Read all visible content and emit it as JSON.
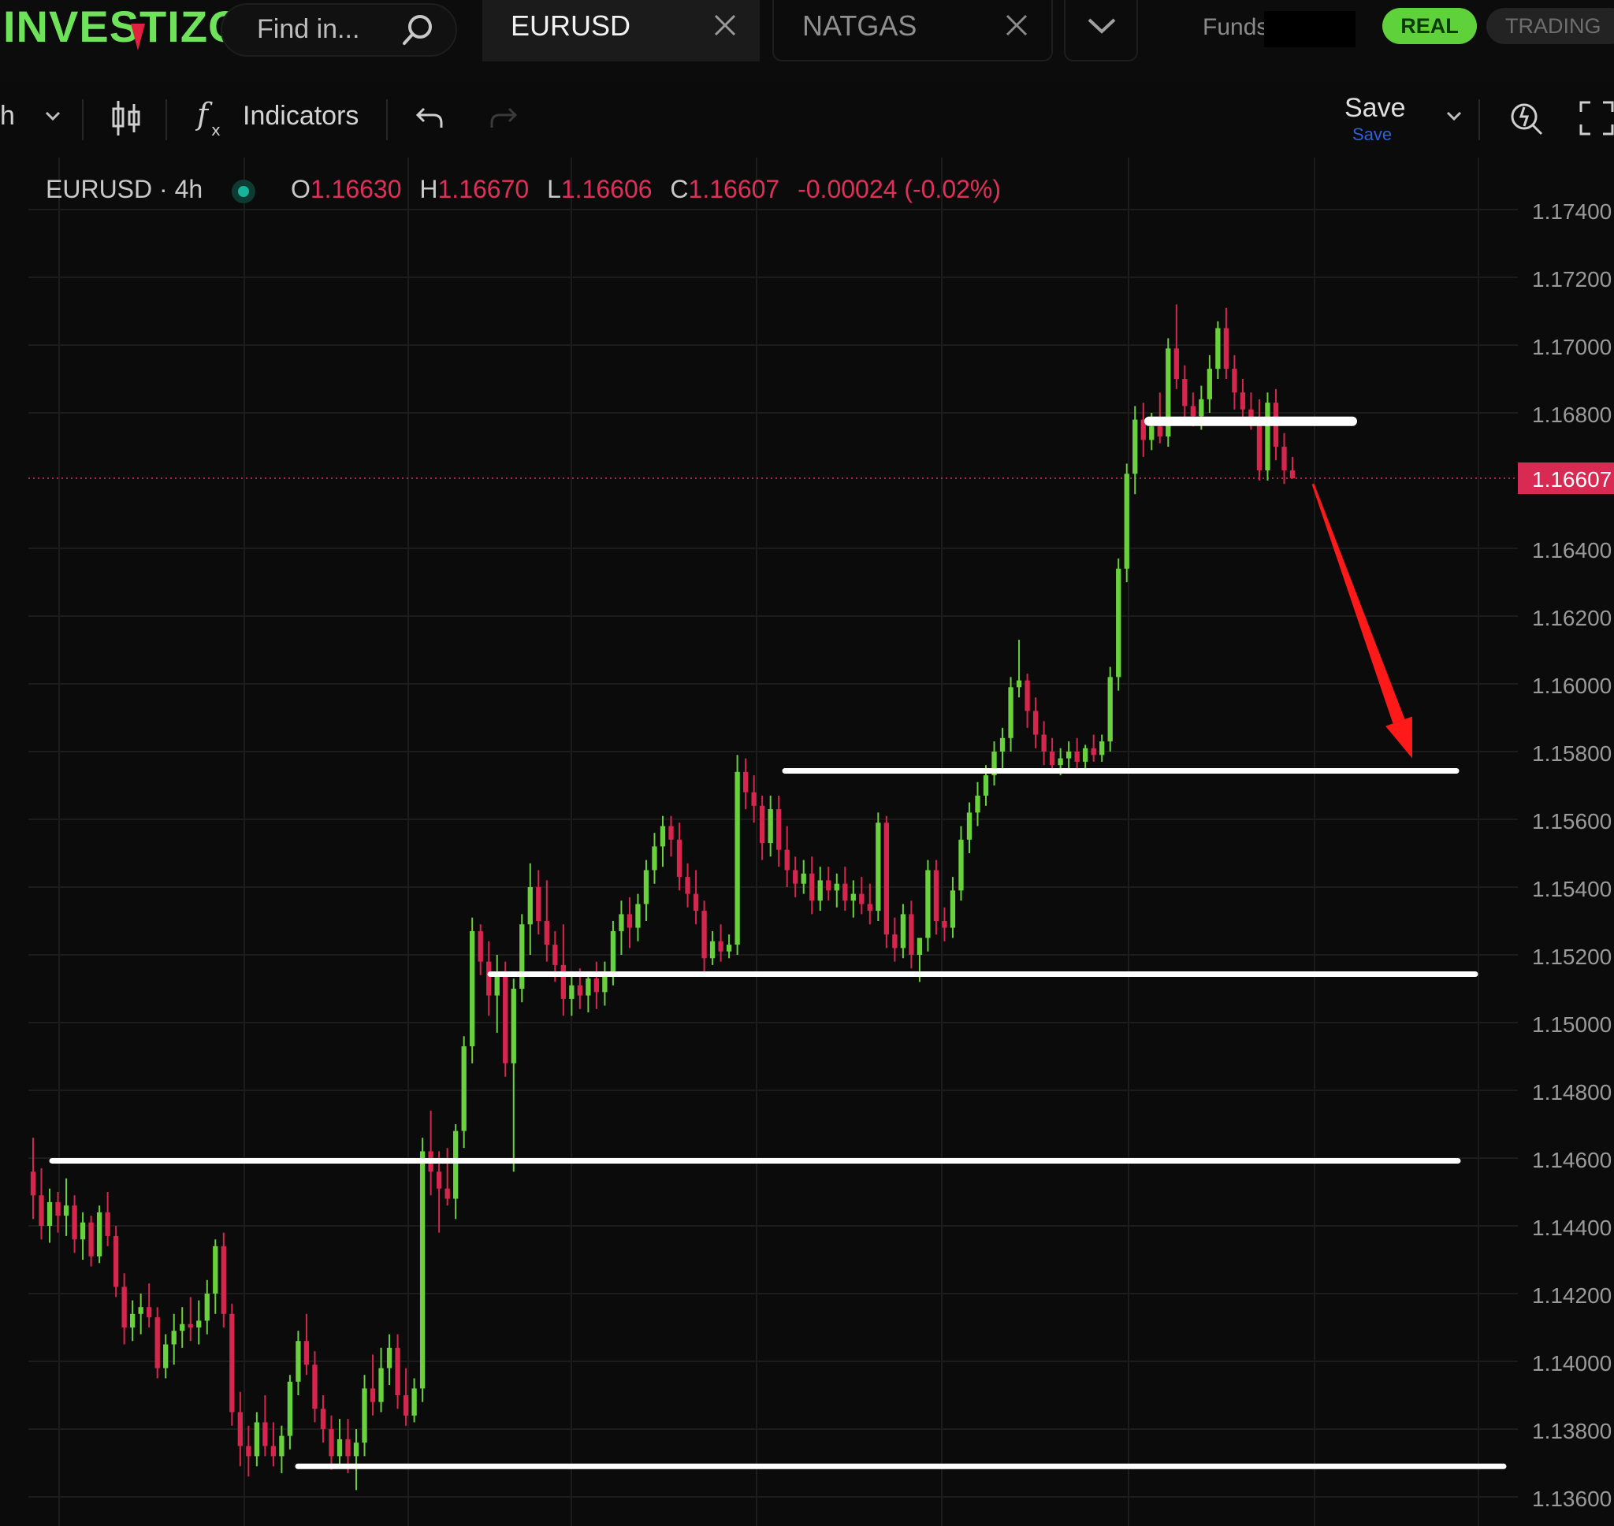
{
  "app": {
    "logo_text": "INVESTIZO"
  },
  "search": {
    "placeholder": "Find in..."
  },
  "tabs": [
    {
      "label": "EURUSD",
      "active": true
    },
    {
      "label": "NATGAS",
      "active": false
    }
  ],
  "account": {
    "funds_label": "Funds",
    "mode_real": "REAL",
    "mode_trading": "TRADING"
  },
  "toolbar": {
    "interval_label": "h",
    "indicators_label": "Indicators",
    "save_label": "Save",
    "save_sub_label": "Save",
    "icons": [
      "chevron-down-icon",
      "candlestick-icon",
      "fx-icon",
      "undo-icon",
      "redo-icon",
      "magic-icon",
      "fullscreen-icon"
    ]
  },
  "legend": {
    "symbol": "EURUSD · 4h",
    "open_key": "O",
    "open": "1.16630",
    "high_key": "H",
    "high": "1.16670",
    "low_key": "L",
    "low": "1.16606",
    "close_key": "C",
    "close": "1.16607",
    "change": "-0.00024 (-0.02%)"
  },
  "colors": {
    "up": "#69d13d",
    "down": "#d6264d",
    "last_price_bg": "#d82a52",
    "accent_real": "#5fd13a",
    "annotation_lines": "#ffffff",
    "arrow": "#ff1a1a"
  },
  "chart_data": {
    "type": "candlestick",
    "symbol": "EURUSD",
    "interval": "4h",
    "ylim": [
      1.1357,
      1.175
    ],
    "y_ticks": [
      "1.17400",
      "1.17200",
      "1.17000",
      "1.16800",
      "1.16400",
      "1.16200",
      "1.16000",
      "1.15800",
      "1.15600",
      "1.15400",
      "1.15200",
      "1.15000",
      "1.14800",
      "1.14600",
      "1.14400",
      "1.14200",
      "1.14000",
      "1.13800",
      "1.13600"
    ],
    "last_price": "1.16607",
    "candles": [
      [
        1.1456,
        1.1466,
        1.1442,
        1.1449
      ],
      [
        1.1449,
        1.1457,
        1.1436,
        1.144
      ],
      [
        1.144,
        1.1451,
        1.1435,
        1.1447
      ],
      [
        1.1447,
        1.145,
        1.1438,
        1.1443
      ],
      [
        1.1443,
        1.1454,
        1.1437,
        1.1446
      ],
      [
        1.1446,
        1.1449,
        1.1432,
        1.1436
      ],
      [
        1.1436,
        1.1444,
        1.143,
        1.1441
      ],
      [
        1.1441,
        1.1443,
        1.1428,
        1.1431
      ],
      [
        1.1431,
        1.1446,
        1.1429,
        1.1444
      ],
      [
        1.1444,
        1.145,
        1.1434,
        1.1437
      ],
      [
        1.1437,
        1.144,
        1.1419,
        1.1422
      ],
      [
        1.1422,
        1.1426,
        1.1405,
        1.141
      ],
      [
        1.141,
        1.1418,
        1.1406,
        1.1414
      ],
      [
        1.1414,
        1.142,
        1.1408,
        1.1416
      ],
      [
        1.1416,
        1.1423,
        1.141,
        1.1413
      ],
      [
        1.1413,
        1.1416,
        1.1395,
        1.1398
      ],
      [
        1.1398,
        1.1408,
        1.1395,
        1.1405
      ],
      [
        1.1405,
        1.1414,
        1.1399,
        1.1409
      ],
      [
        1.1409,
        1.1416,
        1.1404,
        1.1411
      ],
      [
        1.1411,
        1.1419,
        1.1406,
        1.141
      ],
      [
        1.141,
        1.1418,
        1.1405,
        1.1412
      ],
      [
        1.1412,
        1.1424,
        1.1408,
        1.142
      ],
      [
        1.142,
        1.1436,
        1.1414,
        1.1434
      ],
      [
        1.1434,
        1.1438,
        1.141,
        1.1414
      ],
      [
        1.1414,
        1.1417,
        1.1381,
        1.1385
      ],
      [
        1.1385,
        1.1391,
        1.1369,
        1.1375
      ],
      [
        1.1375,
        1.1381,
        1.1366,
        1.1372
      ],
      [
        1.1372,
        1.1385,
        1.1369,
        1.1382
      ],
      [
        1.1382,
        1.139,
        1.1372,
        1.1375
      ],
      [
        1.1375,
        1.1382,
        1.1369,
        1.1372
      ],
      [
        1.1372,
        1.1381,
        1.1367,
        1.1378
      ],
      [
        1.1378,
        1.1396,
        1.1374,
        1.1394
      ],
      [
        1.1394,
        1.1409,
        1.139,
        1.1406
      ],
      [
        1.1406,
        1.1414,
        1.1396,
        1.1399
      ],
      [
        1.1399,
        1.1403,
        1.1382,
        1.1386
      ],
      [
        1.1386,
        1.139,
        1.1376,
        1.138
      ],
      [
        1.138,
        1.1384,
        1.1368,
        1.1372
      ],
      [
        1.1372,
        1.1383,
        1.1369,
        1.1377
      ],
      [
        1.1377,
        1.1383,
        1.1367,
        1.1372
      ],
      [
        1.1372,
        1.138,
        1.1362,
        1.1376
      ],
      [
        1.1376,
        1.1396,
        1.1372,
        1.1392
      ],
      [
        1.1392,
        1.1402,
        1.1384,
        1.1388
      ],
      [
        1.1388,
        1.1404,
        1.1385,
        1.1398
      ],
      [
        1.1398,
        1.1408,
        1.1393,
        1.1404
      ],
      [
        1.1404,
        1.1408,
        1.1386,
        1.139
      ],
      [
        1.139,
        1.1398,
        1.1381,
        1.1384
      ],
      [
        1.1384,
        1.1395,
        1.1382,
        1.1392
      ],
      [
        1.1392,
        1.1466,
        1.1388,
        1.1462
      ],
      [
        1.1462,
        1.1474,
        1.1449,
        1.1456
      ],
      [
        1.1456,
        1.1462,
        1.1438,
        1.1451
      ],
      [
        1.1451,
        1.1463,
        1.1446,
        1.1448
      ],
      [
        1.1448,
        1.147,
        1.1442,
        1.1468
      ],
      [
        1.1468,
        1.1496,
        1.1463,
        1.1493
      ],
      [
        1.1493,
        1.1531,
        1.1488,
        1.1527
      ],
      [
        1.1527,
        1.1529,
        1.1514,
        1.1518
      ],
      [
        1.1518,
        1.1524,
        1.1502,
        1.1508
      ],
      [
        1.1508,
        1.152,
        1.1497,
        1.1515
      ],
      [
        1.1515,
        1.1518,
        1.1484,
        1.1488
      ],
      [
        1.1488,
        1.1513,
        1.1456,
        1.151
      ],
      [
        1.151,
        1.1532,
        1.1506,
        1.1529
      ],
      [
        1.1529,
        1.1547,
        1.152,
        1.154
      ],
      [
        1.154,
        1.1545,
        1.1526,
        1.153
      ],
      [
        1.153,
        1.1542,
        1.1518,
        1.1523
      ],
      [
        1.1523,
        1.1527,
        1.1512,
        1.1517
      ],
      [
        1.1517,
        1.1529,
        1.1502,
        1.1507
      ],
      [
        1.1507,
        1.1514,
        1.1502,
        1.1511
      ],
      [
        1.1511,
        1.1516,
        1.1504,
        1.1508
      ],
      [
        1.1508,
        1.1515,
        1.1503,
        1.1513
      ],
      [
        1.1513,
        1.1518,
        1.1504,
        1.1509
      ],
      [
        1.1509,
        1.1518,
        1.1505,
        1.1515
      ],
      [
        1.1515,
        1.153,
        1.1511,
        1.1527
      ],
      [
        1.1527,
        1.1536,
        1.152,
        1.1532
      ],
      [
        1.1532,
        1.1537,
        1.1522,
        1.1528
      ],
      [
        1.1528,
        1.1538,
        1.1524,
        1.1535
      ],
      [
        1.1535,
        1.1548,
        1.153,
        1.1545
      ],
      [
        1.1545,
        1.1556,
        1.1541,
        1.1552
      ],
      [
        1.1552,
        1.1561,
        1.1546,
        1.1558
      ],
      [
        1.1558,
        1.1561,
        1.1549,
        1.1554
      ],
      [
        1.1554,
        1.1559,
        1.1539,
        1.1543
      ],
      [
        1.1543,
        1.1547,
        1.1534,
        1.1538
      ],
      [
        1.1538,
        1.1545,
        1.1529,
        1.1533
      ],
      [
        1.1533,
        1.1536,
        1.1515,
        1.1519
      ],
      [
        1.1519,
        1.1527,
        1.1517,
        1.1524
      ],
      [
        1.1524,
        1.1529,
        1.1518,
        1.1521
      ],
      [
        1.1521,
        1.1526,
        1.1519,
        1.1523
      ],
      [
        1.1523,
        1.1579,
        1.152,
        1.1574
      ],
      [
        1.1574,
        1.1578,
        1.1563,
        1.1568
      ],
      [
        1.1568,
        1.1573,
        1.1559,
        1.1564
      ],
      [
        1.1564,
        1.1567,
        1.1548,
        1.1553
      ],
      [
        1.1553,
        1.1567,
        1.1549,
        1.1563
      ],
      [
        1.1563,
        1.1567,
        1.1546,
        1.1551
      ],
      [
        1.1551,
        1.1558,
        1.154,
        1.1545
      ],
      [
        1.1545,
        1.1549,
        1.1537,
        1.1541
      ],
      [
        1.1541,
        1.1548,
        1.1538,
        1.1544
      ],
      [
        1.1544,
        1.1549,
        1.1532,
        1.1536
      ],
      [
        1.1536,
        1.1546,
        1.1533,
        1.1542
      ],
      [
        1.1542,
        1.1546,
        1.1536,
        1.1539
      ],
      [
        1.1539,
        1.1544,
        1.1534,
        1.1541
      ],
      [
        1.1541,
        1.1546,
        1.1533,
        1.1536
      ],
      [
        1.1536,
        1.1542,
        1.1531,
        1.1538
      ],
      [
        1.1538,
        1.1543,
        1.1532,
        1.1535
      ],
      [
        1.1535,
        1.1541,
        1.1529,
        1.1533
      ],
      [
        1.1533,
        1.1562,
        1.153,
        1.1559
      ],
      [
        1.1559,
        1.1561,
        1.1522,
        1.1526
      ],
      [
        1.1526,
        1.1531,
        1.1518,
        1.1522
      ],
      [
        1.1522,
        1.1535,
        1.1519,
        1.1532
      ],
      [
        1.1532,
        1.1536,
        1.1516,
        1.152
      ],
      [
        1.152,
        1.1525,
        1.1512,
        1.1525
      ],
      [
        1.1525,
        1.1548,
        1.1521,
        1.1545
      ],
      [
        1.1545,
        1.1548,
        1.1526,
        1.153
      ],
      [
        1.153,
        1.1534,
        1.1524,
        1.1528
      ],
      [
        1.1528,
        1.1543,
        1.1525,
        1.1539
      ],
      [
        1.1539,
        1.1558,
        1.1536,
        1.1554
      ],
      [
        1.1554,
        1.1565,
        1.155,
        1.1562
      ],
      [
        1.1562,
        1.1571,
        1.1558,
        1.1567
      ],
      [
        1.1567,
        1.1576,
        1.1564,
        1.1573
      ],
      [
        1.1573,
        1.1583,
        1.157,
        1.158
      ],
      [
        1.158,
        1.1587,
        1.1575,
        1.1584
      ],
      [
        1.1584,
        1.1602,
        1.158,
        1.1599
      ],
      [
        1.1599,
        1.1613,
        1.1596,
        1.1601
      ],
      [
        1.1601,
        1.1603,
        1.1587,
        1.1592
      ],
      [
        1.1592,
        1.1596,
        1.1581,
        1.1585
      ],
      [
        1.1585,
        1.1589,
        1.1576,
        1.158
      ],
      [
        1.158,
        1.1584,
        1.1574,
        1.1576
      ],
      [
        1.1576,
        1.1581,
        1.1573,
        1.1578
      ],
      [
        1.1578,
        1.1583,
        1.1574,
        1.158
      ],
      [
        1.158,
        1.1584,
        1.1575,
        1.1577
      ],
      [
        1.1577,
        1.1582,
        1.1574,
        1.1581
      ],
      [
        1.1581,
        1.1585,
        1.1577,
        1.1579
      ],
      [
        1.1579,
        1.1585,
        1.1577,
        1.1583
      ],
      [
        1.1583,
        1.1605,
        1.158,
        1.1602
      ],
      [
        1.1602,
        1.1637,
        1.1598,
        1.1634
      ],
      [
        1.1634,
        1.1665,
        1.163,
        1.1662
      ],
      [
        1.1662,
        1.1682,
        1.1656,
        1.1678
      ],
      [
        1.1678,
        1.1683,
        1.1667,
        1.1672
      ],
      [
        1.1672,
        1.168,
        1.1669,
        1.1676
      ],
      [
        1.1676,
        1.1686,
        1.1671,
        1.1673
      ],
      [
        1.1673,
        1.1702,
        1.167,
        1.1699
      ],
      [
        1.1699,
        1.1712,
        1.1687,
        1.169
      ],
      [
        1.169,
        1.1694,
        1.1678,
        1.1682
      ],
      [
        1.1682,
        1.1686,
        1.1676,
        1.1679
      ],
      [
        1.1679,
        1.1688,
        1.1675,
        1.1684
      ],
      [
        1.1684,
        1.1697,
        1.168,
        1.1693
      ],
      [
        1.1693,
        1.1707,
        1.169,
        1.1705
      ],
      [
        1.1705,
        1.1711,
        1.169,
        1.1693
      ],
      [
        1.1693,
        1.1697,
        1.1681,
        1.1686
      ],
      [
        1.1686,
        1.169,
        1.1677,
        1.1681
      ],
      [
        1.1681,
        1.1686,
        1.1675,
        1.1678
      ],
      [
        1.1678,
        1.1684,
        1.166,
        1.1663
      ],
      [
        1.1663,
        1.1686,
        1.166,
        1.1683
      ],
      [
        1.1683,
        1.1687,
        1.1666,
        1.167
      ],
      [
        1.167,
        1.1674,
        1.1659,
        1.1663
      ],
      [
        1.1663,
        1.1667,
        1.16606,
        1.16607
      ]
    ],
    "annotations": {
      "horizontal_levels": [
        1.16775,
        1.15743,
        1.15143,
        1.14592,
        1.1369
      ],
      "arrow": {
        "from_price": 1.1659,
        "to_price": 1.1578
      }
    }
  }
}
